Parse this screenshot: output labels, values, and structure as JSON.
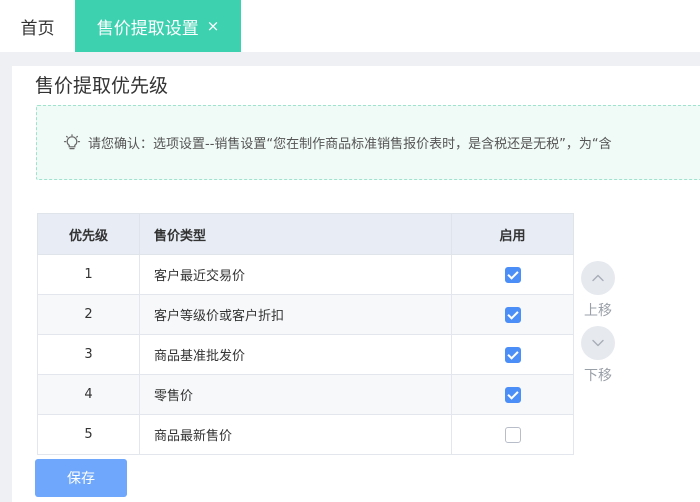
{
  "tabs": {
    "home_label": "首页",
    "active_label": "售价提取设置",
    "close_glyph": "×"
  },
  "section_title": "售价提取优先级",
  "notice": {
    "icon": "lightbulb-icon",
    "text": "请您确认：选项设置--销售设置“您在制作商品标准销售报价表时，是含税还是无税”，为“含"
  },
  "table": {
    "headers": {
      "priority": "优先级",
      "type": "售价类型",
      "enabled": "启用"
    },
    "rows": [
      {
        "priority": "1",
        "type": "客户最近交易价",
        "enabled": true
      },
      {
        "priority": "2",
        "type": "客户等级价或客户折扣",
        "enabled": true
      },
      {
        "priority": "3",
        "type": "商品基准批发价",
        "enabled": true
      },
      {
        "priority": "4",
        "type": "零售价",
        "enabled": true
      },
      {
        "priority": "5",
        "type": "商品最新售价",
        "enabled": false
      }
    ]
  },
  "move_up_label": "上移",
  "move_down_label": "下移",
  "save_label": "保存",
  "colors": {
    "tab_active": "#3ed1b0",
    "checkbox_on": "#4c8ef7",
    "save_button": "#6ea7fb",
    "notice_border": "#9fe3cf"
  }
}
